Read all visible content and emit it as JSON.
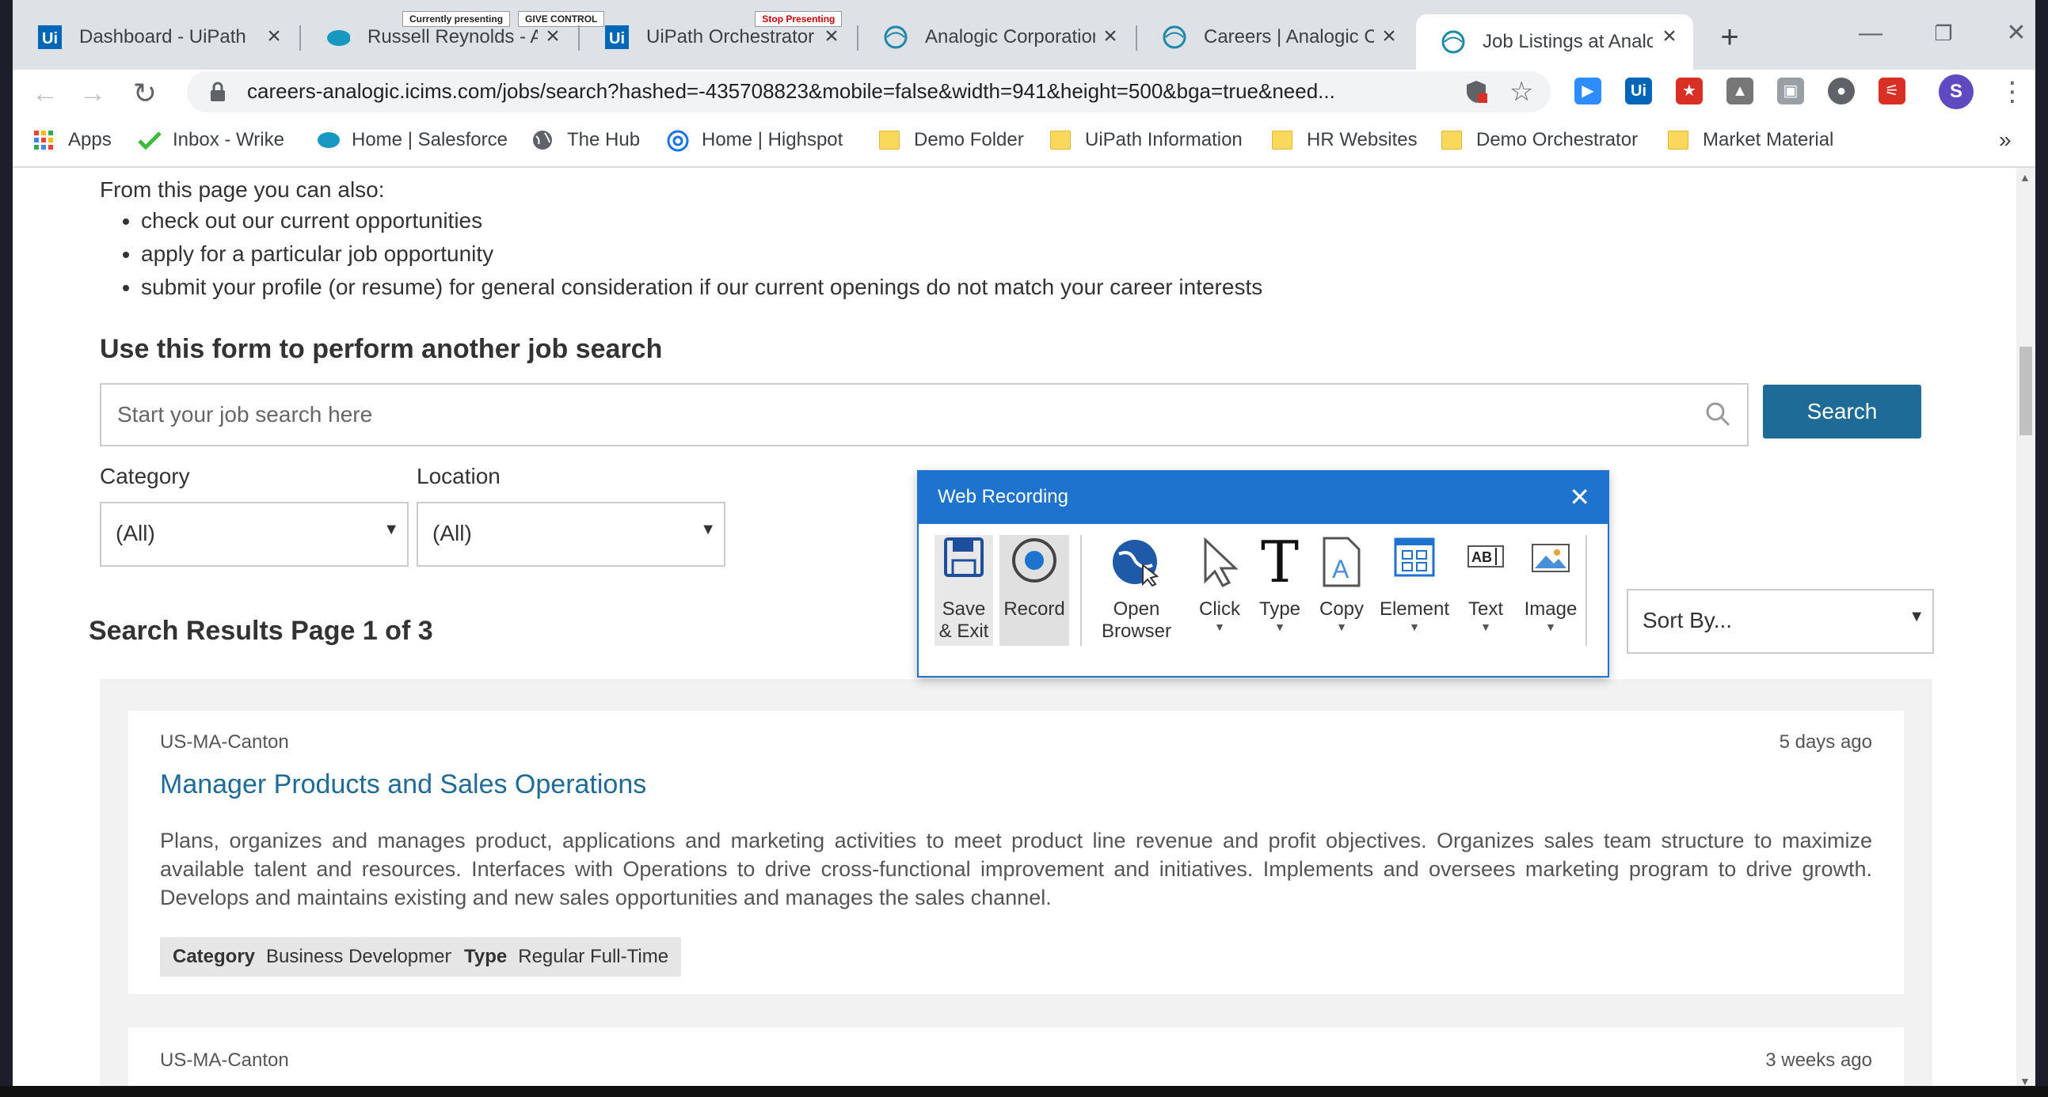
{
  "browser": {
    "tabs": [
      {
        "title": "Dashboard - UiPath O",
        "icon": "uipath-icon"
      },
      {
        "title": "Russell Reynolds - Au",
        "icon": "salesforce-cloud-icon"
      },
      {
        "title": "UiPath Orchestrator",
        "icon": "uipath-icon"
      },
      {
        "title": "Analogic Corporation",
        "icon": "analogic-globe-icon"
      },
      {
        "title": "Careers | Analogic Co",
        "icon": "analogic-globe-icon"
      },
      {
        "title": "Job Listings at Analo",
        "icon": "analogic-globe-icon",
        "active": true
      }
    ],
    "presenting": {
      "status": "Currently presenting",
      "give_control": "GIVE CONTROL",
      "stop": "Stop Presenting"
    },
    "url": "careers-analogic.icims.com/jobs/search?hashed=-435708823&mobile=false&width=941&height=500&bga=true&need...",
    "profile_initial": "S",
    "bookmarks": [
      {
        "label": "Apps",
        "icon": "apps-grid-icon"
      },
      {
        "label": "Inbox - Wrike",
        "icon": "wrike-check-icon"
      },
      {
        "label": "Home | Salesforce",
        "icon": "salesforce-cloud-icon"
      },
      {
        "label": "The Hub",
        "icon": "globe-icon"
      },
      {
        "label": "Home | Highspot",
        "icon": "highspot-icon"
      },
      {
        "label": "Demo Folder",
        "icon": "folder-icon"
      },
      {
        "label": "UiPath Information",
        "icon": "folder-icon"
      },
      {
        "label": "HR Websites",
        "icon": "folder-icon"
      },
      {
        "label": "Demo Orchestrator",
        "icon": "folder-icon"
      },
      {
        "label": "Market Material",
        "icon": "folder-icon"
      }
    ],
    "bookmarks_overflow": "»"
  },
  "page": {
    "intro": "From this page you can also:",
    "options": [
      "check out our current opportunities",
      "apply for a particular job opportunity",
      "submit your profile (or resume) for general consideration if our current openings do not match your career interests"
    ],
    "form_title": "Use this form to perform another job search",
    "search_placeholder": "Start your job search here",
    "search_button": "Search",
    "category_label": "Category",
    "category_value": "(All)",
    "location_label": "Location",
    "location_value": "(All)",
    "sort_value": "Sort By...",
    "results_title": "Search Results Page 1 of 3",
    "jobs": [
      {
        "location": "US-MA-Canton",
        "posted": "5 days ago",
        "title": "Manager Products and Sales Operations",
        "description": "Plans, organizes and manages product, applications and marketing activities to meet product line revenue and profit objectives. Organizes sales team structure to maximize available talent and resources. Interfaces with Operations to drive cross-functional improvement and initiatives. Implements and oversees marketing program to drive growth.  Develops and maintains existing and new sales opportunities and manages the sales channel.",
        "category_label": "Category",
        "category": "Business Development",
        "type_label": "Type",
        "type": "Regular Full-Time"
      },
      {
        "location": "US-MA-Canton",
        "posted": "3 weeks ago"
      }
    ]
  },
  "web_recording": {
    "title": "Web Recording",
    "buttons": [
      {
        "label": "Save & Exit",
        "icon": "floppy-disk-icon"
      },
      {
        "label": "Record",
        "icon": "record-icon"
      },
      {
        "label": "Open Browser",
        "icon": "globe-cursor-icon"
      },
      {
        "label": "Click",
        "icon": "cursor-arrow-icon"
      },
      {
        "label": "Type",
        "icon": "type-t-icon"
      },
      {
        "label": "Copy",
        "icon": "copy-document-icon"
      },
      {
        "label": "Element",
        "icon": "element-grid-icon"
      },
      {
        "label": "Text",
        "icon": "text-ocr-icon"
      },
      {
        "label": "Image",
        "icon": "image-icon"
      }
    ]
  },
  "colors": {
    "accent_blue": "#1e6b97",
    "recorder_blue": "#1e73cf",
    "tab_strip": "#dee1e6"
  }
}
